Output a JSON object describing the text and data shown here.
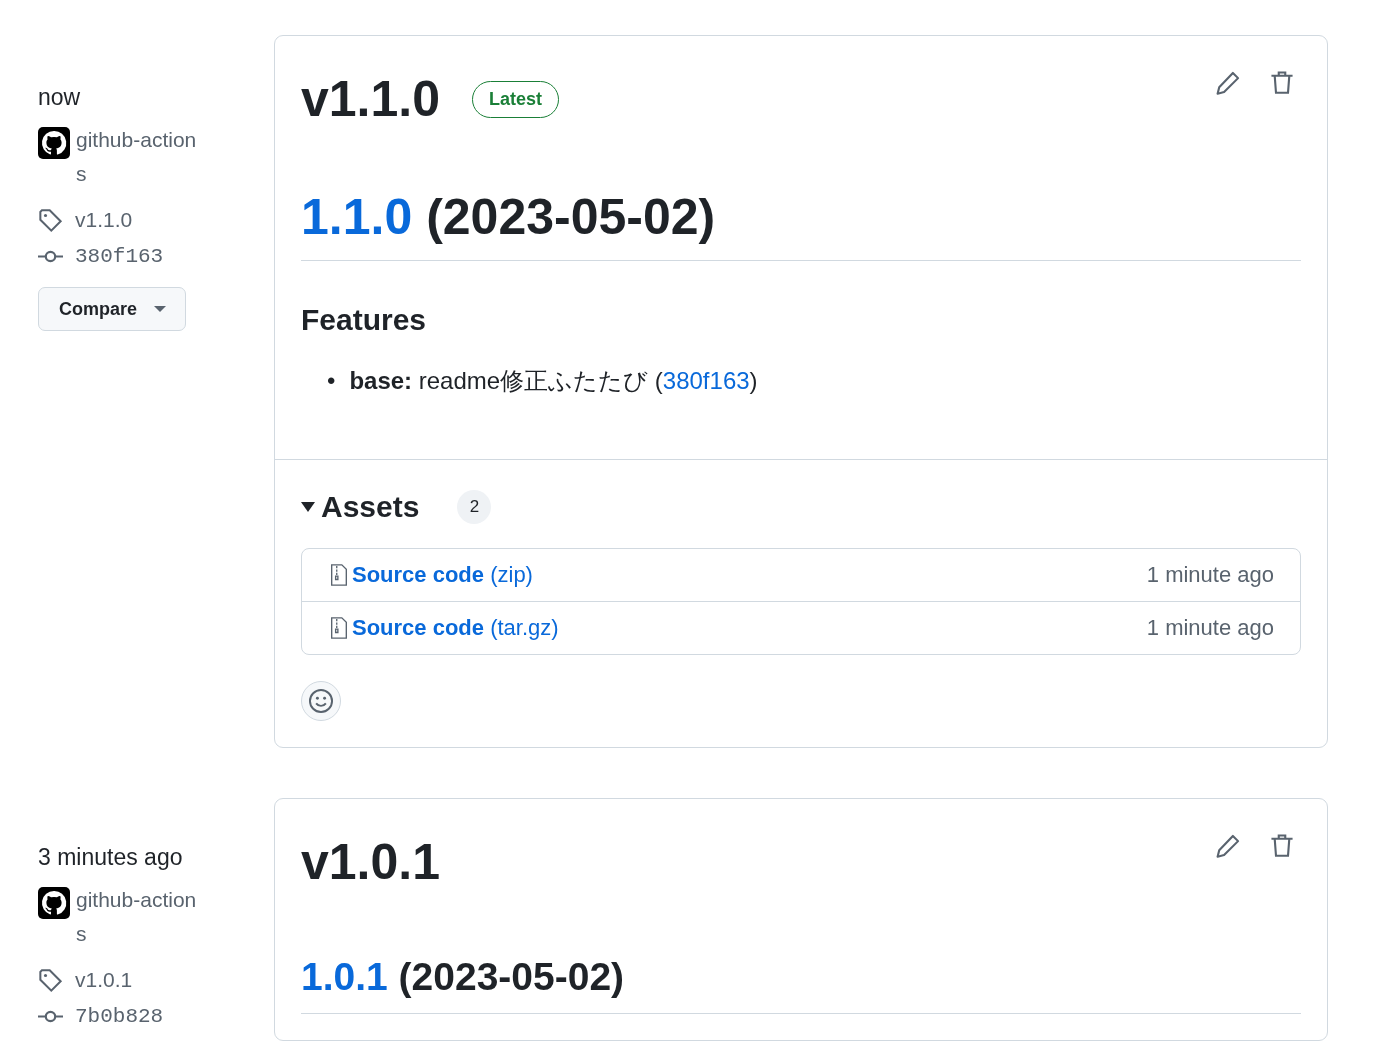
{
  "releases": [
    {
      "time": "now",
      "author": "github-actions",
      "tag": "v1.1.0",
      "commit": "380f163",
      "compare": "Compare",
      "title": "v1.1.0",
      "latest": true,
      "latest_label": "Latest",
      "heading": {
        "kind": "h1",
        "link": "1.1.0",
        "rest": "(2023-05-02)"
      },
      "sections": [
        {
          "heading": "Features",
          "items": [
            {
              "marker": "•",
              "bold": "base:",
              "text": "readme修正ふたたび (",
              "link": "380f163",
              "after": ")"
            }
          ]
        }
      ],
      "assets": {
        "label": "Assets",
        "count": "2",
        "expanded": true,
        "items": [
          {
            "name": "Source code",
            "format": "(zip)",
            "time": "1 minute ago"
          },
          {
            "name": "Source code",
            "format": "(tar.gz)",
            "time": "1 minute ago"
          }
        ]
      }
    },
    {
      "time": "3 minutes ago",
      "author": "github-actions",
      "tag": "v1.0.1",
      "commit": "7b0b828",
      "title": "v1.0.1",
      "latest": false,
      "heading": {
        "kind": "h2",
        "link": "1.0.1",
        "rest": "(2023-05-02)"
      }
    }
  ]
}
